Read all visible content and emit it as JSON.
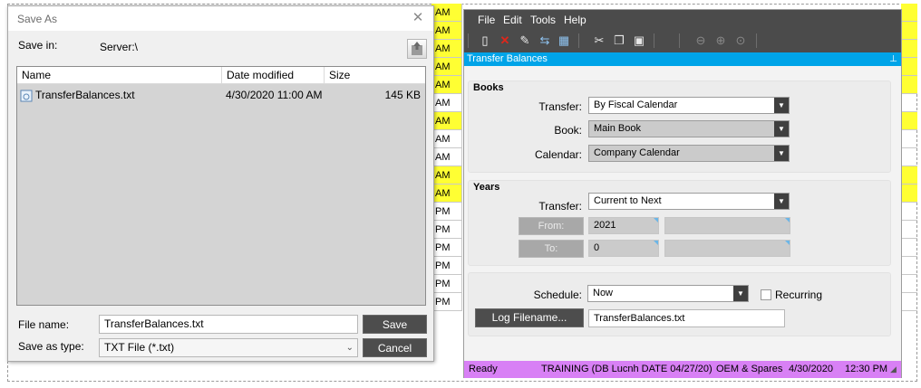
{
  "background": {
    "col_values": [
      "AM",
      "AM",
      "AM",
      "AM",
      "AM",
      "AM",
      "AM",
      "AM",
      "AM",
      "AM",
      "AM",
      "PM",
      "PM",
      "PM",
      "PM",
      "PM",
      "PM"
    ],
    "highlight_color": "#ffff33"
  },
  "save_dialog": {
    "title": "Save As",
    "save_in_label": "Save in:",
    "save_in_value": "Server:\\",
    "columns": [
      "Name",
      "Date modified",
      "Size"
    ],
    "files": [
      {
        "name": "TransferBalances.txt",
        "date": "4/30/2020 11:00 AM",
        "size": "145 KB"
      }
    ],
    "file_name_label": "File name:",
    "file_name_value": "TransferBalances.txt",
    "save_type_label": "Save as type:",
    "save_type_value": "TXT File (*.txt)",
    "save_button": "Save",
    "cancel_button": "Cancel"
  },
  "app": {
    "menu": [
      "File",
      "Edit",
      "Tools",
      "Help"
    ],
    "panel_title": "Transfer Balances",
    "books": {
      "title": "Books",
      "transfer_label": "Transfer:",
      "transfer_value": "By Fiscal Calendar",
      "book_label": "Book:",
      "book_value": "Main Book",
      "calendar_label": "Calendar:",
      "calendar_value": "Company Calendar"
    },
    "years": {
      "title": "Years",
      "transfer_label": "Transfer:",
      "transfer_value": "Current to Next",
      "from_button": "From:",
      "from_value": "2021",
      "to_button": "To:",
      "to_value": "0"
    },
    "schedule": {
      "schedule_label": "Schedule:",
      "schedule_value": "Now",
      "recurring_label": "Recurring",
      "log_button": "Log Filename...",
      "log_value": "TransferBalances.txt"
    },
    "status": {
      "ready": "Ready",
      "session": "TRAINING (DB Lucnh DATE 04/27/20)",
      "company": "OEM & Spares",
      "date": "4/30/2020",
      "time": "12:30 PM"
    },
    "accent_color": "#00a4e8",
    "status_color": "#d880f5"
  }
}
